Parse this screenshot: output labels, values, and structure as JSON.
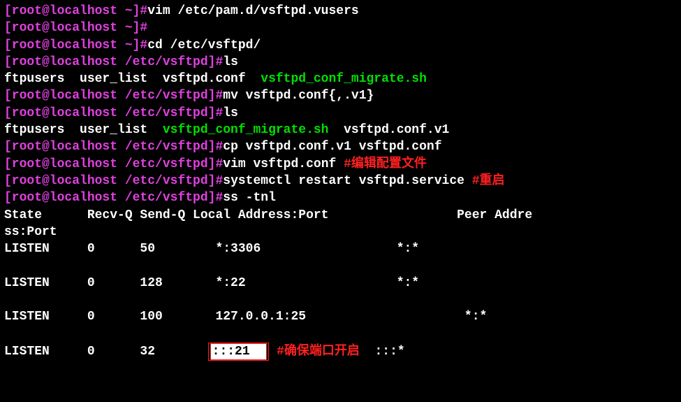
{
  "lines": {
    "l1": {
      "prompt": "[root@localhost ~]#",
      "cmd": "vim /etc/pam.d/vsftpd.vusers"
    },
    "l2": {
      "prompt": "[root@localhost ~]#"
    },
    "l3": {
      "prompt": "[root@localhost ~]#",
      "cmd": "cd /etc/vsftpd/"
    },
    "l4": {
      "prompt": "[root@localhost /etc/vsftpd]#",
      "cmd": "ls"
    },
    "l5": {
      "out1": "ftpusers  user_list  vsftpd.conf  ",
      "green": "vsftpd_conf_migrate.sh"
    },
    "l6": {
      "prompt": "[root@localhost /etc/vsftpd]#",
      "cmd": "mv vsftpd.conf{,.v1}"
    },
    "l7": {
      "prompt": "[root@localhost /etc/vsftpd]#",
      "cmd": "ls"
    },
    "l8": {
      "out1": "ftpusers  user_list  ",
      "green": "vsftpd_conf_migrate.sh",
      "out2": "  vsftpd.conf.v1"
    },
    "l9": {
      "prompt": "[root@localhost /etc/vsftpd]#",
      "cmd": "cp vsftpd.conf.v1 vsftpd.conf"
    },
    "l10": {
      "prompt": "[root@localhost /etc/vsftpd]#",
      "cmd": "vim vsftpd.conf ",
      "note": "#编辑配置文件"
    },
    "l11": {
      "prompt": "[root@localhost /etc/vsftpd]#",
      "cmd": "systemctl restart vsftpd.service ",
      "note": "#重启"
    },
    "l12": {
      "prompt": "[root@localhost /etc/vsftpd]#",
      "cmd": "ss -tnl"
    },
    "header1": "State      Recv-Q Send-Q Local Address:Port                 Peer Addre",
    "header2": "ss:Port",
    "row1": "LISTEN     0      50        *:3306                  *:*                  ",
    "row2": "LISTEN     0      128       *:22                    *:*                  ",
    "row3": "LISTEN     0      100       127.0.0.1:25                     *:*                  ",
    "row4a": "LISTEN     0      32       ",
    "row4_highlight": ":::21  ",
    "row4_note": " #确保端口开启  ",
    "row4b": ":::*                  "
  }
}
